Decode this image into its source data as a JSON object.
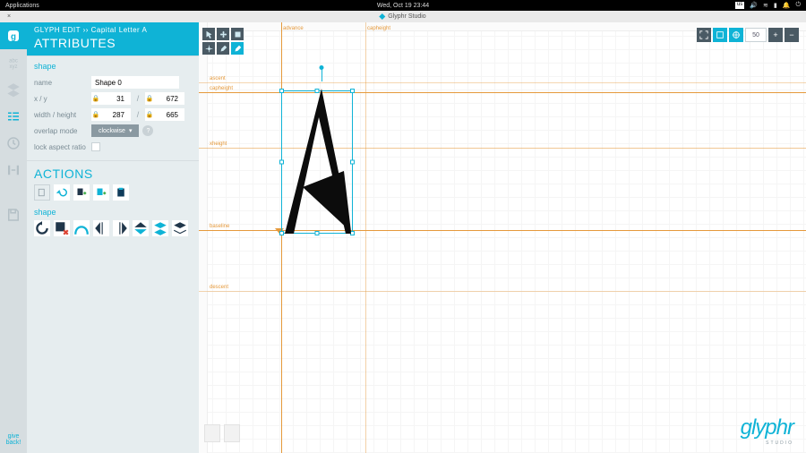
{
  "system_bar": {
    "applications_label": "Applications",
    "clock": "Wed, Oct 19   23:44",
    "tray_icons": [
      "us-keyboard",
      "volume",
      "wifi",
      "battery",
      "notifications",
      "power"
    ]
  },
  "window": {
    "close_glyph": "×",
    "title": "Glyphr Studio"
  },
  "rail": {
    "items": [
      {
        "name": "glyph-edit",
        "active": true
      },
      {
        "name": "character-set"
      },
      {
        "name": "layers"
      },
      {
        "name": "guides"
      },
      {
        "name": "history"
      },
      {
        "name": "kerning"
      },
      {
        "name": "save"
      }
    ],
    "give_back": "give\nback!"
  },
  "panel": {
    "breadcrumb_prefix": "GLYPH EDIT",
    "breadcrumb_sep": "››",
    "breadcrumb_current": "Capital Letter A",
    "title": "ATTRIBUTES",
    "shape": {
      "heading": "shape",
      "name_label": "name",
      "name_value": "Shape 0",
      "xy_label": "x  /  y",
      "x_value": "31",
      "y_value": "672",
      "wh_label": "width  /  height",
      "w_value": "287",
      "h_value": "665",
      "overlap_label": "overlap mode",
      "overlap_value": "clockwise",
      "lock_label": "lock aspect ratio"
    },
    "actions": {
      "heading": "ACTIONS",
      "row1": [
        "copy",
        "undo",
        "paste-plus",
        "add-shape",
        "paste-clipboard"
      ],
      "shape_sub": "shape",
      "row2": [
        "rotate-ccw",
        "delete-shape",
        "curve",
        "flip-v-left",
        "flip-v-right",
        "flip-h",
        "layers-tool",
        "layer-down"
      ]
    }
  },
  "canvas": {
    "guides": {
      "advance_label": "advance",
      "capheight_label": "capheight",
      "ascent_label": "ascent",
      "xheight_label": "xheight",
      "baseline_label": "baseline",
      "descent_label": "descent"
    },
    "mode_buttons": [
      "pointer",
      "pan",
      "shape",
      "add-point",
      "pen",
      "path"
    ],
    "view": {
      "zoom_value": "50"
    }
  },
  "logo": {
    "text": "glyphr",
    "sub": "STUDIO"
  }
}
